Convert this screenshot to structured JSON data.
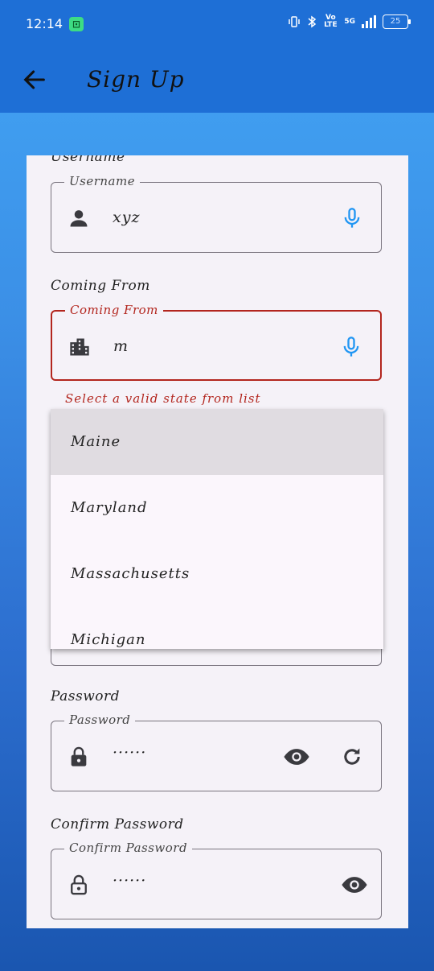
{
  "status_bar": {
    "time": "12:14",
    "network_label": "Vo LTE",
    "network_type": "5G",
    "battery": "25"
  },
  "app_bar": {
    "title": "Sign Up"
  },
  "form": {
    "username": {
      "section_label": "Username",
      "floating_label": "Username",
      "value": "xyz"
    },
    "coming_from": {
      "section_label": "Coming From",
      "floating_label": "Coming From",
      "value": "m",
      "error": "Select a valid state from list"
    },
    "password": {
      "section_label": "Password",
      "floating_label": "Password",
      "value": "······"
    },
    "confirm_password": {
      "section_label": "Confirm Password",
      "floating_label": "Confirm Password",
      "value": "······"
    }
  },
  "dropdown": {
    "options": [
      "Maine",
      "Maryland",
      "Massachusetts",
      "Michigan"
    ]
  },
  "colors": {
    "primary": "#1e6fd6",
    "error": "#b3261e",
    "mic": "#2196f3",
    "card": "#f5f2f8"
  }
}
